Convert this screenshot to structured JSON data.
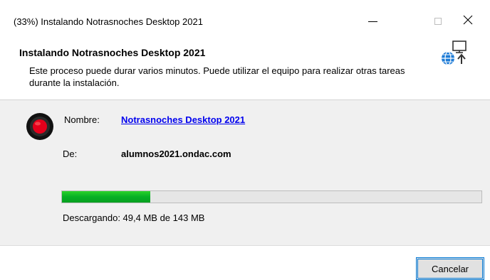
{
  "window": {
    "title": "(33%) Instalando Notrasnoches Desktop 2021",
    "controls": {
      "minimize": "minimize-icon",
      "maximize": "maximize-icon",
      "close": "close-icon",
      "close_glyph": "✕"
    }
  },
  "header": {
    "title": "Instalando Notrasnoches Desktop 2021",
    "description": "Este proceso puede durar varios minutos. Puede utilizar el equipo para realizar otras tareas durante la instalación.",
    "icon": "network-install-icon"
  },
  "details": {
    "app_icon": "record-icon",
    "name_label": "Nombre:",
    "name_value": "Notrasnoches Desktop 2021",
    "from_label": "De:",
    "from_value": "alumnos2021.ondac.com"
  },
  "progress": {
    "fraction": 0.21,
    "status": "Descargando: 49,4 MB de 143 MB"
  },
  "footer": {
    "cancel_label": "Cancelar"
  },
  "colors": {
    "progress_green": "#06b025",
    "link_blue": "#0000ee",
    "accent_blue": "#0078d7",
    "panel_gray": "#f0f0f0"
  }
}
